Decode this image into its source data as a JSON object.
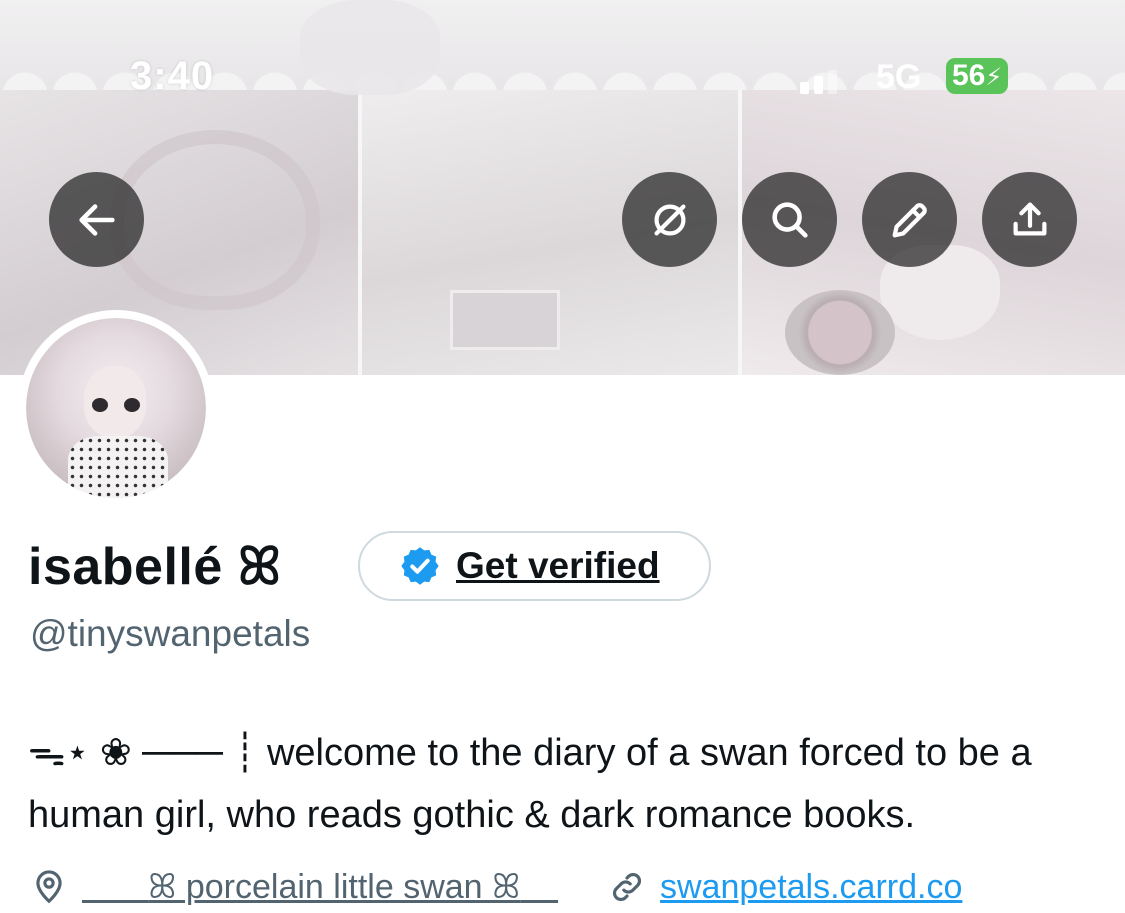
{
  "status_bar": {
    "time": "3:40",
    "network": "5G",
    "battery": "56"
  },
  "banner": {
    "description_icons": [
      "back-arrow-icon",
      "grok-icon",
      "search-icon",
      "pencil-icon",
      "share-icon"
    ]
  },
  "profile": {
    "display_name": "isabellé ꕤ",
    "handle": "@tinyswanpetals",
    "verify_label": "Get verified",
    "bio": "ᯓ⋆ ❀ ─── ┊ welcome to the diary of a swan forced to be a human girl, who reads gothic & dark romance books.",
    "location": "ꕤ porcelain little swan ꕤ",
    "website": "swanpetals.carrd.co"
  },
  "colors": {
    "text_primary": "#0f1419",
    "text_secondary": "#536471",
    "link": "#1d9bf0",
    "verified_badge": "#1d9bf0",
    "battery": "#5ac35a"
  }
}
